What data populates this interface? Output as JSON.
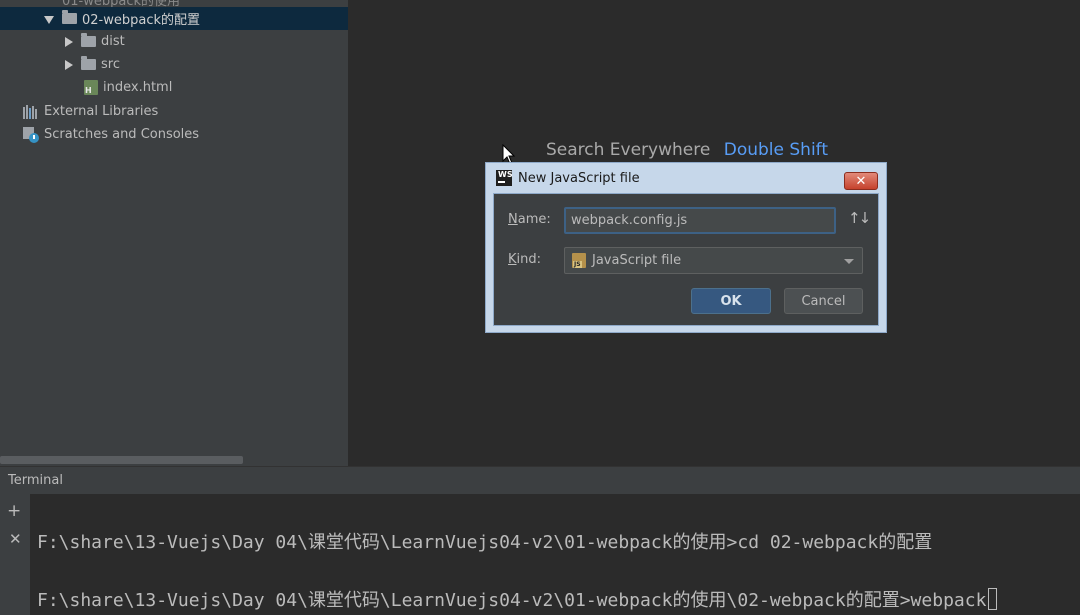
{
  "project_tree": {
    "partial_top_label": "01-webpack的使用",
    "items": [
      {
        "label": "02-webpack的配置",
        "type": "folder",
        "expanded": true,
        "selected": true
      },
      {
        "label": "dist",
        "type": "folder",
        "expanded": false
      },
      {
        "label": "src",
        "type": "folder",
        "expanded": false
      },
      {
        "label": "index.html",
        "type": "html-file"
      },
      {
        "label": "External Libraries",
        "type": "libraries"
      },
      {
        "label": "Scratches and Consoles",
        "type": "scratches"
      }
    ]
  },
  "editor": {
    "search_hint": "Search Everywhere",
    "search_shortcut": "Double Shift"
  },
  "dialog": {
    "title": "New JavaScript file",
    "logo": "WS",
    "close_symbol": "✕",
    "name_label_key": "N",
    "name_label_rest": "ame:",
    "name_value": "webpack.config.js",
    "kind_label_key": "K",
    "kind_label_rest": "ind:",
    "kind_value": "JavaScript file",
    "ok_label": "OK",
    "cancel_label": "Cancel",
    "sort_icon": "↑↓"
  },
  "terminal": {
    "title": "Terminal",
    "add_symbol": "+",
    "close_symbol": "✕",
    "lines": [
      "F:\\share\\13-Vuejs\\Day 04\\课堂代码\\LearnVuejs04-v2\\01-webpack的使用>cd 02-webpack的配置",
      "F:\\share\\13-Vuejs\\Day 04\\课堂代码\\LearnVuejs04-v2\\01-webpack的使用\\02-webpack的配置>webpack"
    ]
  },
  "colors": {
    "accent_link": "#589df6",
    "selection": "#0d293e",
    "ok_button": "#365880"
  }
}
